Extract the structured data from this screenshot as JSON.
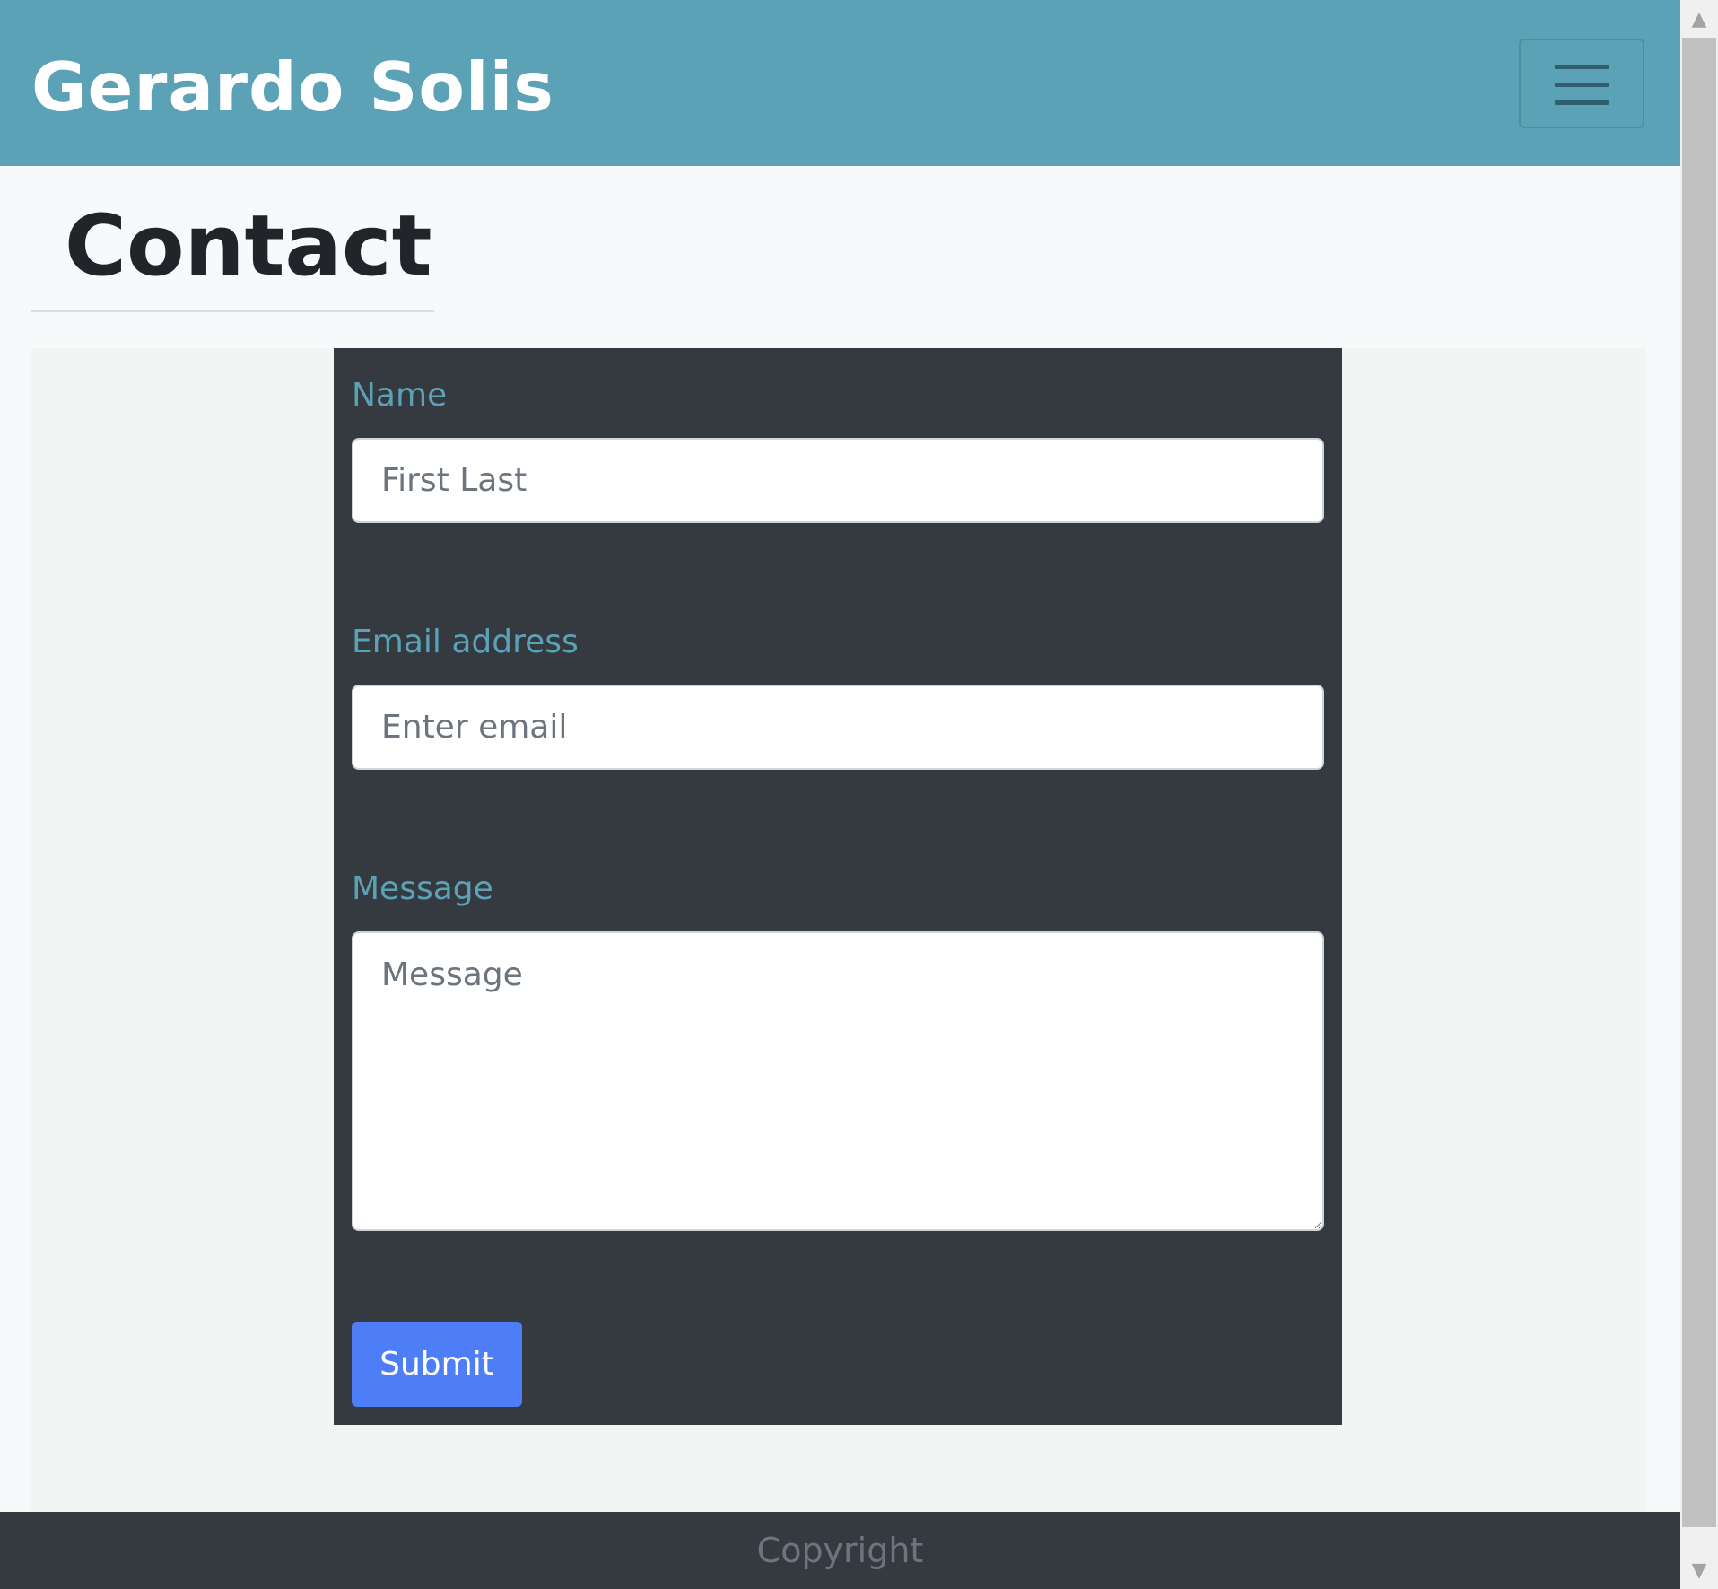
{
  "navbar": {
    "brand": "Gerardo Solis",
    "toggler_icon": "hamburger-menu-icon"
  },
  "page": {
    "title": "Contact"
  },
  "form": {
    "name_label": "Name",
    "name_placeholder": "First Last",
    "email_label": "Email address",
    "email_placeholder": "Enter email",
    "message_label": "Message",
    "message_placeholder": "Message",
    "submit_label": "Submit"
  },
  "footer": {
    "text": "Copyright"
  },
  "scrollbar": {
    "up_icon": "chevron-up-icon",
    "down_icon": "chevron-down-icon"
  },
  "colors": {
    "navbar": "#5ba2b6",
    "form_card": "#343a40",
    "label": "#5ba2b6",
    "submit": "#4e7ef7",
    "footer": "#343a40"
  }
}
